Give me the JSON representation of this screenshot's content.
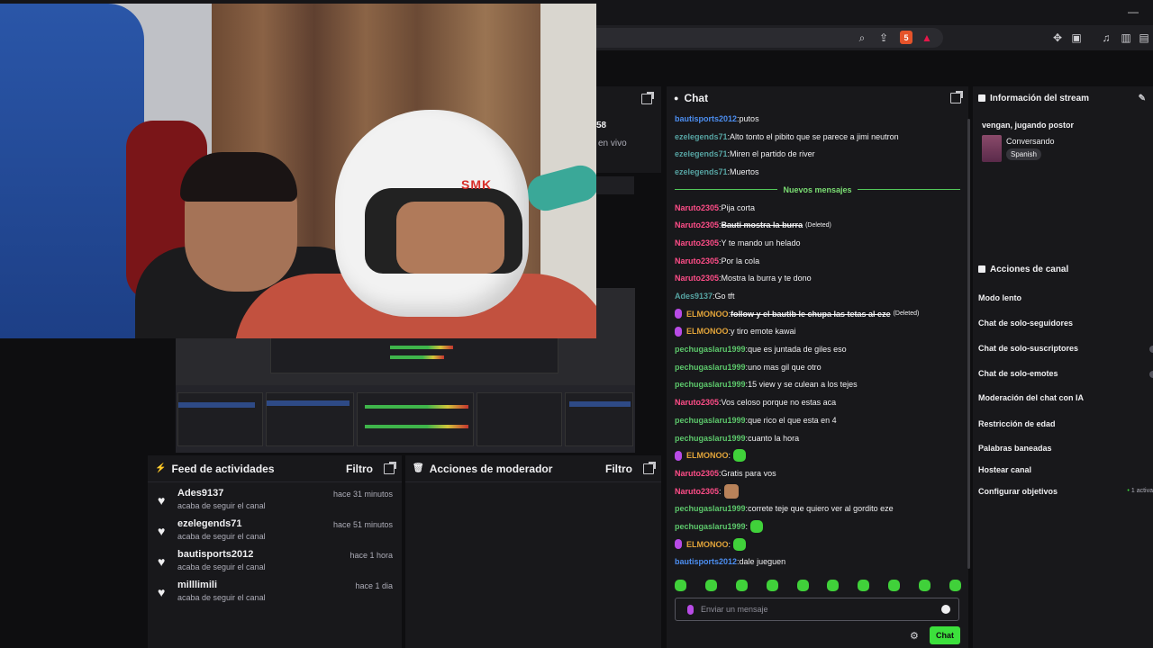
{
  "browser": {
    "minimize": "—",
    "brave_badge": "5"
  },
  "behind_webcam": {
    "viewer_count": "58",
    "live_text": "en vivo"
  },
  "feed": {
    "title": "Feed de actividades",
    "filter": "Filtro",
    "items": [
      {
        "name": "Ades9137",
        "sub": "acaba de seguir el canal",
        "time": "hace 31 minutos"
      },
      {
        "name": "ezelegends71",
        "sub": "acaba de seguir el canal",
        "time": "hace 51 minutos"
      },
      {
        "name": "bautisports2012",
        "sub": "acaba de seguir el canal",
        "time": "hace 1 hora"
      },
      {
        "name": "milllimili",
        "sub": "acaba de seguir el canal",
        "time": "hace 1 dia"
      }
    ]
  },
  "mod": {
    "title": "Acciones de moderador",
    "filter": "Filtro"
  },
  "chat": {
    "title": "Chat",
    "new_messages": "Nuevos mensajes",
    "placeholder": "Enviar un mensaje",
    "send": "Chat",
    "messages_before": [
      {
        "user": "bautisports2012",
        "color": "blue",
        "text": "putos"
      },
      {
        "user": "ezelegends71",
        "color": "teal",
        "text": "Alto tonto el pibito que se parece a jimi neutron"
      },
      {
        "user": "ezelegends71",
        "color": "teal",
        "text": "Miren el partido de river"
      },
      {
        "user": "ezelegends71",
        "color": "teal",
        "text": "Muertos"
      }
    ],
    "messages_after": [
      {
        "user": "Naruto2305",
        "color": "pink",
        "text": "Pija corta"
      },
      {
        "user": "Naruto2305",
        "color": "pink",
        "text": "Bauti mostra la burra",
        "deleted": "(Deleted)"
      },
      {
        "user": "Naruto2305",
        "color": "pink",
        "text": "Y te mando un helado"
      },
      {
        "user": "Naruto2305",
        "color": "pink",
        "text": "Por la cola"
      },
      {
        "user": "Naruto2305",
        "color": "pink",
        "text": "Mostra la burra y te dono"
      },
      {
        "user": "Ades9137",
        "color": "teal",
        "text": "Go tft"
      },
      {
        "user": "ELMONOO",
        "color": "orange",
        "badge": true,
        "text": "follow y el bautib le chupa las tetas al eze",
        "deleted": "(Deleted)"
      },
      {
        "user": "ELMONOO",
        "color": "orange",
        "badge": true,
        "text": "y tiro emote kawai"
      },
      {
        "user": "pechugaslaru1999",
        "color": "green",
        "text": "que es juntada de giles eso"
      },
      {
        "user": "pechugaslaru1999",
        "color": "green",
        "text": "uno mas gil que otro"
      },
      {
        "user": "pechugaslaru1999",
        "color": "green",
        "text": "15 view y se culean a los tejes"
      },
      {
        "user": "Naruto2305",
        "color": "pink",
        "text": "Vos celoso porque no estas aca"
      },
      {
        "user": "pechugaslaru1999",
        "color": "green",
        "text": "que rico el que esta en 4"
      },
      {
        "user": "pechugaslaru1999",
        "color": "green",
        "text": "cuanto la hora"
      },
      {
        "user": "ELMONOO",
        "color": "orange",
        "badge": true,
        "text": "",
        "emote": "green"
      },
      {
        "user": "Naruto2305",
        "color": "pink",
        "text": "Gratis para vos"
      },
      {
        "user": "Naruto2305",
        "color": "pink",
        "text": "",
        "emote": "cat"
      },
      {
        "user": "pechugaslaru1999",
        "color": "green",
        "text": "correte teje que quiero ver al gordito eze"
      },
      {
        "user": "pechugaslaru1999",
        "color": "green",
        "text": "",
        "emote": "green"
      },
      {
        "user": "ELMONOO",
        "color": "orange",
        "badge": true,
        "text": "",
        "emote": "green"
      },
      {
        "user": "bautisports2012",
        "color": "blue",
        "text": "dale jueguen"
      }
    ]
  },
  "stream_info": {
    "title": "Información del stream",
    "stream_title": "vengan, jugando postor",
    "category": "Conversando",
    "tag": "Spanish"
  },
  "channel_actions": {
    "title": "Acciones de canal",
    "items": [
      "Modo lento",
      "Chat de solo-seguidores",
      "Chat de solo-suscriptores",
      "Chat de solo-emotes",
      "Moderación del chat con IA",
      "Restricción de edad",
      "Palabras baneadas",
      "Hostear canal",
      "Configurar objetivos"
    ],
    "goals_active": "1 activa"
  },
  "colors": {
    "blue": "#4c8ef1",
    "teal": "#56a3a2",
    "pink": "#ff4d88",
    "green": "#5cc76b",
    "orange": "#e2a43a",
    "accent": "#3ce03c"
  }
}
